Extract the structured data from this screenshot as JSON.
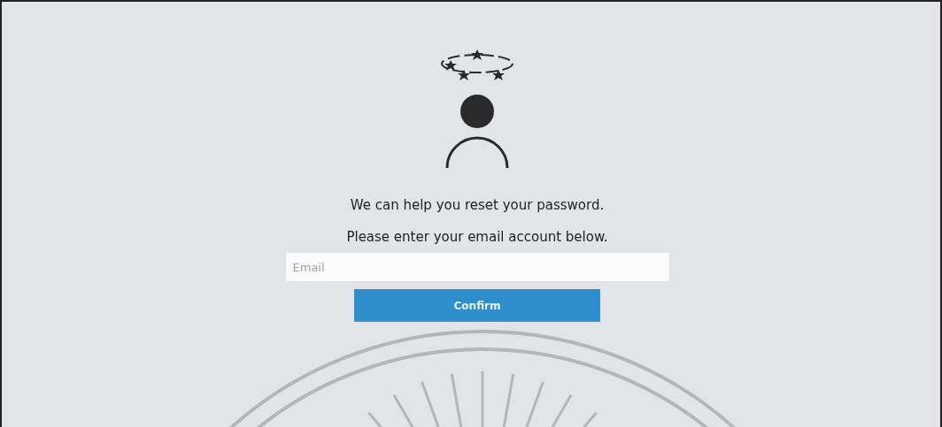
{
  "messages": [
    "We can help you reset your password.",
    "Please enter your email account below."
  ],
  "email_field": {
    "placeholder": "Email"
  },
  "confirm_button": {
    "label": "Confirm"
  }
}
